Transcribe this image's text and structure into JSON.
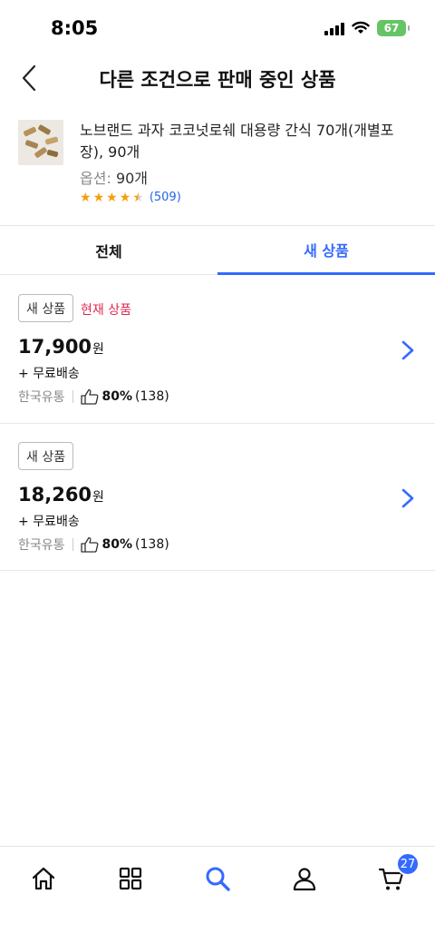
{
  "status_bar": {
    "time": "8:05",
    "battery": "67"
  },
  "header": {
    "title": "다른 조건으로 판매 중인 상품",
    "back_icon": "chevron-left-icon"
  },
  "product": {
    "name": "노브랜드 과자 코코넛로쉐 대용량 간식 70개(개별포장), 90개",
    "option_label": "옵션:",
    "option_value": "90개",
    "rating": 4.5,
    "review_count": "(509)"
  },
  "tabs": [
    {
      "label": "전체",
      "active": false
    },
    {
      "label": "새 상품",
      "active": true
    }
  ],
  "offers": [
    {
      "badge": "새 상품",
      "current_tag": "현재 상품",
      "price": "17,900",
      "currency": "원",
      "shipping": "+ 무료배송",
      "seller": "한국유통",
      "positive_pct": "80%",
      "rating_count": "(138)"
    },
    {
      "badge": "새 상품",
      "current_tag": "",
      "price": "18,260",
      "currency": "원",
      "shipping": "+ 무료배송",
      "seller": "한국유통",
      "positive_pct": "80%",
      "rating_count": "(138)"
    }
  ],
  "tab_bar": {
    "items": [
      "home-icon",
      "category-icon",
      "search-icon",
      "user-icon",
      "cart-icon"
    ],
    "active": "search-icon",
    "cart_count": "27"
  },
  "colors": {
    "accent": "#346aff",
    "current_tag": "#e0294f",
    "star": "#f59e0b",
    "review_link": "#2563eb"
  }
}
